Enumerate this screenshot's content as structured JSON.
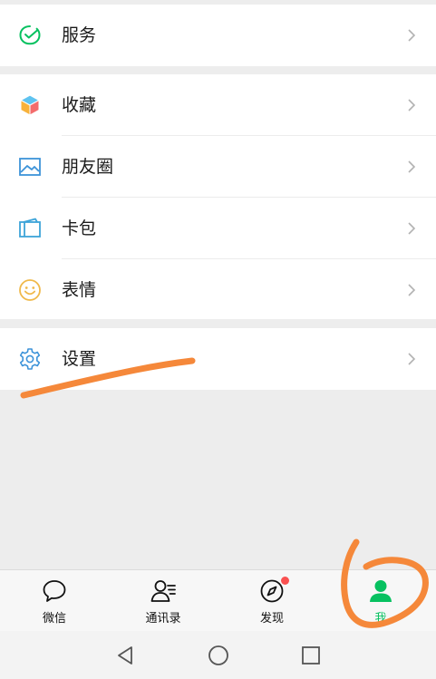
{
  "menu": {
    "services": {
      "label": "服务",
      "icon": "wechat-pay-icon"
    },
    "favorites": {
      "label": "收藏",
      "icon": "cube-icon"
    },
    "moments": {
      "label": "朋友圈",
      "icon": "image-icon"
    },
    "cards": {
      "label": "卡包",
      "icon": "card-wallet-icon"
    },
    "stickers": {
      "label": "表情",
      "icon": "smiley-icon"
    },
    "settings": {
      "label": "设置",
      "icon": "gear-icon"
    }
  },
  "tabbar": {
    "chats": {
      "label": "微信",
      "icon": "chat-bubble-icon"
    },
    "contacts": {
      "label": "通讯录",
      "icon": "contacts-icon"
    },
    "discover": {
      "label": "发现",
      "icon": "compass-icon",
      "has_badge": true
    },
    "me": {
      "label": "我",
      "icon": "person-icon",
      "active": true
    }
  },
  "system_nav": {
    "back": "back-triangle-icon",
    "home": "home-circle-icon",
    "recents": "recents-square-icon"
  },
  "colors": {
    "brand_green": "#07c160",
    "badge_red": "#fa5151",
    "annotation_orange": "#f5883a",
    "background": "#ededed"
  }
}
